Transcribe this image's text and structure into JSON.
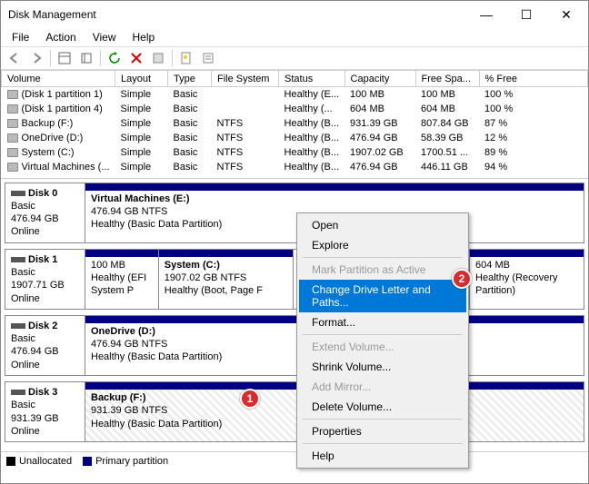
{
  "window": {
    "title": "Disk Management"
  },
  "menu": {
    "file": "File",
    "action": "Action",
    "view": "View",
    "help": "Help"
  },
  "columns": {
    "volume": "Volume",
    "layout": "Layout",
    "type": "Type",
    "fs": "File System",
    "status": "Status",
    "capacity": "Capacity",
    "free": "Free Spa...",
    "pctfree": "% Free"
  },
  "volumes": [
    {
      "name": "(Disk 1 partition 1)",
      "layout": "Simple",
      "type": "Basic",
      "fs": "",
      "status": "Healthy (E...",
      "capacity": "100 MB",
      "free": "100 MB",
      "pct": "100 %"
    },
    {
      "name": "(Disk 1 partition 4)",
      "layout": "Simple",
      "type": "Basic",
      "fs": "",
      "status": "Healthy (...",
      "capacity": "604 MB",
      "free": "604 MB",
      "pct": "100 %"
    },
    {
      "name": "Backup (F:)",
      "layout": "Simple",
      "type": "Basic",
      "fs": "NTFS",
      "status": "Healthy (B...",
      "capacity": "931.39 GB",
      "free": "807.84 GB",
      "pct": "87 %"
    },
    {
      "name": "OneDrive (D:)",
      "layout": "Simple",
      "type": "Basic",
      "fs": "NTFS",
      "status": "Healthy (B...",
      "capacity": "476.94 GB",
      "free": "58.39 GB",
      "pct": "12 %"
    },
    {
      "name": "System (C:)",
      "layout": "Simple",
      "type": "Basic",
      "fs": "NTFS",
      "status": "Healthy (B...",
      "capacity": "1907.02 GB",
      "free": "1700.51 ...",
      "pct": "89 %"
    },
    {
      "name": "Virtual Machines (...",
      "layout": "Simple",
      "type": "Basic",
      "fs": "NTFS",
      "status": "Healthy (B...",
      "capacity": "476.94 GB",
      "free": "446.11 GB",
      "pct": "94 %"
    }
  ],
  "disks": [
    {
      "id": "Disk 0",
      "kind": "Basic",
      "size": "476.94 GB",
      "state": "Online",
      "parts": [
        {
          "title": "Virtual Machines  (E:)",
          "sub1": "476.94 GB NTFS",
          "sub2": "Healthy (Basic Data Partition)",
          "flex": 1,
          "bar": "bar-primary"
        }
      ]
    },
    {
      "id": "Disk 1",
      "kind": "Basic",
      "size": "1907.71 GB",
      "state": "Online",
      "parts": [
        {
          "title": "",
          "sub1": "100 MB",
          "sub2": "Healthy (EFI System P",
          "flex": 0.15,
          "bar": "bar-primary"
        },
        {
          "title": "System  (C:)",
          "sub1": "1907.02 GB NTFS",
          "sub2": "Healthy (Boot, Page F",
          "flex": 0.3,
          "bar": "bar-primary"
        },
        {
          "title": "",
          "sub1": "",
          "sub2": "",
          "flex": 0.4,
          "bar": ""
        },
        {
          "title": "",
          "sub1": "604 MB",
          "sub2": "Healthy (Recovery Partition)",
          "flex": 0.25,
          "bar": "bar-primary"
        }
      ]
    },
    {
      "id": "Disk 2",
      "kind": "Basic",
      "size": "476.94 GB",
      "state": "Online",
      "parts": [
        {
          "title": "OneDrive  (D:)",
          "sub1": "476.94 GB NTFS",
          "sub2": "Healthy (Basic Data Partition)",
          "flex": 1,
          "bar": "bar-primary"
        }
      ]
    },
    {
      "id": "Disk 3",
      "kind": "Basic",
      "size": "931.39 GB",
      "state": "Online",
      "parts": [
        {
          "title": "Backup  (F:)",
          "sub1": "931.39 GB NTFS",
          "sub2": "Healthy (Basic Data Partition)",
          "flex": 1,
          "bar": "bar-primary",
          "hatched": true
        }
      ]
    }
  ],
  "legend": {
    "unalloc": "Unallocated",
    "primary": "Primary partition"
  },
  "ctx": {
    "open": "Open",
    "explore": "Explore",
    "markactive": "Mark Partition as Active",
    "changeletter": "Change Drive Letter and Paths...",
    "format": "Format...",
    "extend": "Extend Volume...",
    "shrink": "Shrink Volume...",
    "mirror": "Add Mirror...",
    "delete": "Delete Volume...",
    "props": "Properties",
    "help": "Help"
  },
  "badges": {
    "b1": "1",
    "b2": "2"
  }
}
